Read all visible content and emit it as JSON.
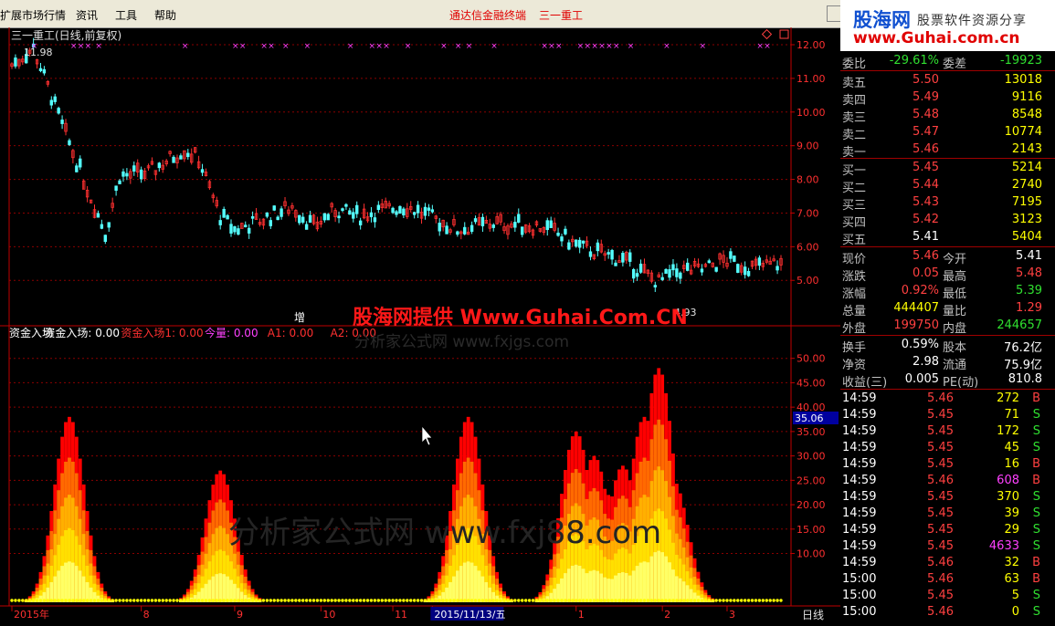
{
  "menu": {
    "items": [
      "扩展市场行情",
      "资讯",
      "工具",
      "帮助"
    ],
    "center_title": "通达信金融终端",
    "stock_title": "三一重工"
  },
  "banner": {
    "logo": "股海网",
    "slogan": "股票软件资源分享",
    "url": "www.Guhai.com.cn"
  },
  "watermark": {
    "main": "股海网提供 Www.Guhai.Com.CN",
    "sub": "分析家公式网 www.fxjgs.com",
    "big": "分析家公式网 www.fxj88.com"
  },
  "kline": {
    "title": "三一重工(日线,前复权)",
    "high_label": "11.98",
    "low_label": "4.93",
    "marker_label": "增",
    "price_axis": [
      "12.00",
      "11.00",
      "10.00",
      "9.00",
      "8.00",
      "7.00",
      "6.00",
      "5.00"
    ],
    "price_range": [
      4.6,
      12.0
    ],
    "bar_count": 215,
    "anchors": [
      [
        0,
        11.4
      ],
      [
        6,
        11.9
      ],
      [
        14,
        9.6
      ],
      [
        20,
        8.0
      ],
      [
        26,
        6.4
      ],
      [
        30,
        8.1
      ],
      [
        38,
        8.2
      ],
      [
        48,
        8.9
      ],
      [
        52,
        8.6
      ],
      [
        58,
        6.9
      ],
      [
        62,
        6.5
      ],
      [
        72,
        6.9
      ],
      [
        78,
        7.2
      ],
      [
        84,
        6.6
      ],
      [
        90,
        7.1
      ],
      [
        96,
        6.9
      ],
      [
        104,
        7.1
      ],
      [
        110,
        7.2
      ],
      [
        116,
        6.9
      ],
      [
        124,
        6.5
      ],
      [
        134,
        6.7
      ],
      [
        148,
        6.6
      ],
      [
        158,
        6.0
      ],
      [
        170,
        5.6
      ],
      [
        180,
        4.95
      ],
      [
        186,
        5.3
      ],
      [
        192,
        5.3
      ],
      [
        198,
        5.6
      ],
      [
        206,
        5.4
      ],
      [
        214,
        5.5
      ]
    ],
    "x_marks": [
      6,
      17,
      19,
      21,
      24,
      48,
      62,
      64,
      70,
      72,
      76,
      82,
      94,
      100,
      102,
      104,
      110,
      120,
      124,
      127,
      134,
      148,
      150,
      152,
      158,
      160,
      162,
      164,
      166,
      168,
      172,
      182,
      192,
      208,
      210
    ]
  },
  "indicator": {
    "legend": [
      {
        "text": "资金入场",
        "color": "#ffffff"
      },
      {
        "text": "资金入场: 0.00",
        "color": "#ffffff"
      },
      {
        "text": "资金入场1: 0.00",
        "color": "#ff3030"
      },
      {
        "text": "今量: 0.00",
        "color": "#ff40ff"
      },
      {
        "text": "A1: 0.00",
        "color": "#ff3030"
      },
      {
        "text": "A2: 0.00",
        "color": "#ff3030"
      }
    ],
    "axis": [
      "50.00",
      "45.00",
      "40.00",
      "35.00",
      "30.00",
      "25.00",
      "20.00",
      "15.00",
      "10.00"
    ],
    "range": [
      0,
      52
    ],
    "current_value": "35.06",
    "current_level": 35.06,
    "spikes": [
      [
        16,
        38
      ],
      [
        58,
        27
      ],
      [
        127,
        38
      ],
      [
        157,
        35
      ],
      [
        162,
        30
      ],
      [
        166,
        22
      ],
      [
        170,
        28
      ],
      [
        176,
        38
      ],
      [
        180,
        48
      ],
      [
        184,
        25
      ]
    ]
  },
  "date_axis": {
    "labels": [
      {
        "text": "2015年",
        "bar": 0
      },
      {
        "text": "8",
        "bar": 36
      },
      {
        "text": "9",
        "bar": 62
      },
      {
        "text": "10",
        "bar": 86
      },
      {
        "text": "11",
        "bar": 106
      },
      {
        "text": "2015/11/13/五",
        "bar": 117,
        "highlight": true
      },
      {
        "text": "1",
        "bar": 157
      },
      {
        "text": "2",
        "bar": 181
      },
      {
        "text": "3",
        "bar": 199
      }
    ],
    "period_label": "日线"
  },
  "quote": {
    "webi": {
      "label": "委比",
      "value": "-29.61%",
      "label2": "委差",
      "value2": "-19923"
    },
    "sell": [
      {
        "label": "卖五",
        "price": "5.50",
        "vol": "13018"
      },
      {
        "label": "卖四",
        "price": "5.49",
        "vol": "9116"
      },
      {
        "label": "卖三",
        "price": "5.48",
        "vol": "8548"
      },
      {
        "label": "卖二",
        "price": "5.47",
        "vol": "10774"
      },
      {
        "label": "卖一",
        "price": "5.46",
        "vol": "2143"
      }
    ],
    "buy": [
      {
        "label": "买一",
        "price": "5.45",
        "vol": "5214"
      },
      {
        "label": "买二",
        "price": "5.44",
        "vol": "2740"
      },
      {
        "label": "买三",
        "price": "5.43",
        "vol": "7195"
      },
      {
        "label": "买四",
        "price": "5.42",
        "vol": "3123"
      },
      {
        "label": "买五",
        "price": "5.41",
        "vol": "5404"
      }
    ],
    "stats": [
      {
        "l1": "现价",
        "v1": "5.46",
        "c1": "red",
        "l2": "今开",
        "v2": "5.41",
        "c2": "wht"
      },
      {
        "l1": "涨跌",
        "v1": "0.05",
        "c1": "red",
        "l2": "最高",
        "v2": "5.48",
        "c2": "red"
      },
      {
        "l1": "涨幅",
        "v1": "0.92%",
        "c1": "red",
        "l2": "最低",
        "v2": "5.39",
        "c2": "grn"
      },
      {
        "l1": "总量",
        "v1": "444407",
        "c1": "yel",
        "l2": "量比",
        "v2": "1.29",
        "c2": "red"
      },
      {
        "l1": "外盘",
        "v1": "199750",
        "c1": "red",
        "l2": "内盘",
        "v2": "244657",
        "c2": "grn"
      }
    ],
    "finance": [
      {
        "l1": "换手",
        "v1": "0.59%",
        "l2": "股本",
        "v2": "76.2亿"
      },
      {
        "l1": "净资",
        "v1": "2.98",
        "l2": "流通",
        "v2": "75.9亿"
      },
      {
        "l1": "收益(三)",
        "v1": "0.005",
        "l2": "PE(动)",
        "v2": "810.8"
      }
    ]
  },
  "ticks": [
    {
      "time": "14:59",
      "price": "5.46",
      "vol": "272",
      "side": "B"
    },
    {
      "time": "14:59",
      "price": "5.45",
      "vol": "71",
      "side": "S"
    },
    {
      "time": "14:59",
      "price": "5.45",
      "vol": "172",
      "side": "S"
    },
    {
      "time": "14:59",
      "price": "5.45",
      "vol": "45",
      "side": "S"
    },
    {
      "time": "14:59",
      "price": "5.45",
      "vol": "16",
      "side": "B"
    },
    {
      "time": "14:59",
      "price": "5.46",
      "vol": "608",
      "side": "B"
    },
    {
      "time": "14:59",
      "price": "5.45",
      "vol": "370",
      "side": "S"
    },
    {
      "time": "14:59",
      "price": "5.45",
      "vol": "39",
      "side": "S"
    },
    {
      "time": "14:59",
      "price": "5.45",
      "vol": "29",
      "side": "S"
    },
    {
      "time": "14:59",
      "price": "5.45",
      "vol": "4633",
      "side": "S"
    },
    {
      "time": "14:59",
      "price": "5.46",
      "vol": "32",
      "side": "B"
    },
    {
      "time": "15:00",
      "price": "5.46",
      "vol": "63",
      "side": "B"
    },
    {
      "time": "15:00",
      "price": "5.45",
      "vol": "5",
      "side": "S"
    },
    {
      "time": "15:00",
      "price": "5.46",
      "vol": "0",
      "side": "S"
    }
  ],
  "colors": {
    "up": "#ff3030",
    "down": "#54ffff",
    "grid": "#8b0000",
    "axis": "#c00000",
    "buy": "#ff3030",
    "sell": "#30e030"
  }
}
